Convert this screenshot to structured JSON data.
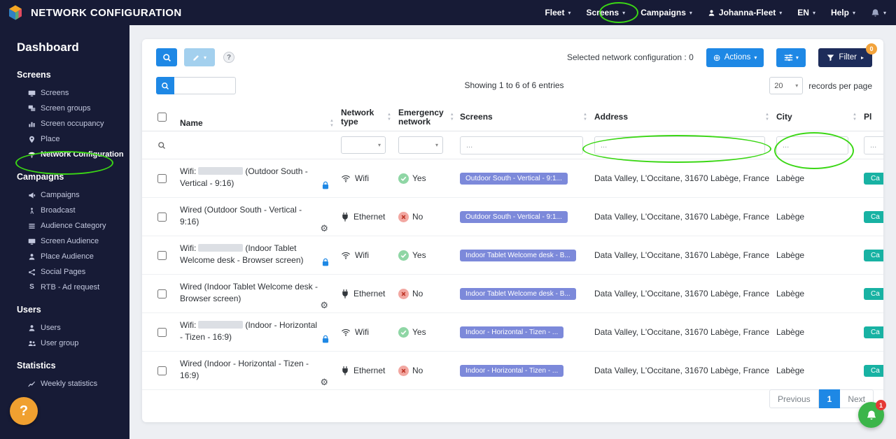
{
  "topbar": {
    "title": "NETWORK CONFIGURATION",
    "fleet": "Fleet",
    "screens": "Screens",
    "campaigns": "Campaigns",
    "user": "Johanna-Fleet",
    "lang": "EN",
    "help": "Help"
  },
  "sidebar": {
    "dashboard": "Dashboard",
    "sections": [
      {
        "title": "Screens",
        "items": [
          {
            "label": "Screens"
          },
          {
            "label": "Screen groups"
          },
          {
            "label": "Screen occupancy"
          },
          {
            "label": "Place"
          },
          {
            "label": "Network Configuration"
          }
        ]
      },
      {
        "title": "Campaigns",
        "items": [
          {
            "label": "Campaigns"
          },
          {
            "label": "Broadcast"
          },
          {
            "label": "Audience Category"
          },
          {
            "label": "Screen Audience"
          },
          {
            "label": "Place Audience"
          },
          {
            "label": "Social Pages"
          },
          {
            "label": "RTB - Ad request"
          }
        ]
      },
      {
        "title": "Users",
        "items": [
          {
            "label": "Users"
          },
          {
            "label": "User group"
          }
        ]
      },
      {
        "title": "Statistics",
        "items": [
          {
            "label": "Weekly statistics"
          }
        ]
      }
    ],
    "help_button": "?"
  },
  "toolbar": {
    "selected_label": "Selected network configuration : 0",
    "actions_label": "Actions",
    "filter_label": "Filter",
    "filter_badge": "0"
  },
  "listing": {
    "showing": "Showing 1 to 6 of 6 entries",
    "per_page_value": "20",
    "per_page_label": "records per page"
  },
  "table": {
    "headers": {
      "name": "Name",
      "network_type": "Network type",
      "emergency_network": "Emergency network",
      "screens": "Screens",
      "address": "Address",
      "city": "City",
      "place": "Pl"
    },
    "filter_placeholder": "...",
    "rows": [
      {
        "name_prefix": "Wifi:",
        "name_suffix": "(Outdoor South - Vertical - 9:16)",
        "network_type": "Wifi",
        "emergency": "Yes",
        "screens_badge": "Outdoor South - Vertical - 9:1...",
        "address": "Data Valley, L'Occitane, 31670 Labège, France",
        "city": "Labège",
        "place_badge": "Ca"
      },
      {
        "name_prefix": "Wired (Outdoor South - Vertical - 9:16)",
        "name_suffix": "",
        "network_type": "Ethernet",
        "emergency": "No",
        "screens_badge": "Outdoor South - Vertical - 9:1...",
        "address": "Data Valley, L'Occitane, 31670 Labège, France",
        "city": "Labège",
        "place_badge": "Ca"
      },
      {
        "name_prefix": "Wifi:",
        "name_suffix": "(Indoor Tablet Welcome desk - Browser screen)",
        "network_type": "Wifi",
        "emergency": "Yes",
        "screens_badge": "Indoor Tablet Welcome desk - B...",
        "address": "Data Valley, L'Occitane, 31670 Labège, France",
        "city": "Labège",
        "place_badge": "Ca"
      },
      {
        "name_prefix": "Wired (Indoor Tablet Welcome desk - Browser screen)",
        "name_suffix": "",
        "network_type": "Ethernet",
        "emergency": "No",
        "screens_badge": "Indoor Tablet Welcome desk - B...",
        "address": "Data Valley, L'Occitane, 31670 Labège, France",
        "city": "Labège",
        "place_badge": "Ca"
      },
      {
        "name_prefix": "Wifi:",
        "name_suffix": "(Indoor - Horizontal - Tizen - 16:9)",
        "network_type": "Wifi",
        "emergency": "Yes",
        "screens_badge": "Indoor - Horizontal - Tizen - ...",
        "address": "Data Valley, L'Occitane, 31670 Labège, France",
        "city": "Labège",
        "place_badge": "Ca"
      },
      {
        "name_prefix": "Wired (Indoor - Horizontal - Tizen - 16:9)",
        "name_suffix": "",
        "network_type": "Ethernet",
        "emergency": "No",
        "screens_badge": "Indoor - Horizontal - Tizen - ...",
        "address": "Data Valley, L'Occitane, 31670 Labège, France",
        "city": "Labège",
        "place_badge": "Ca"
      }
    ]
  },
  "pagination": {
    "previous": "Previous",
    "page": "1",
    "next": "Next"
  },
  "floating": {
    "badge": "1"
  },
  "annotation_color": "#3bd715"
}
